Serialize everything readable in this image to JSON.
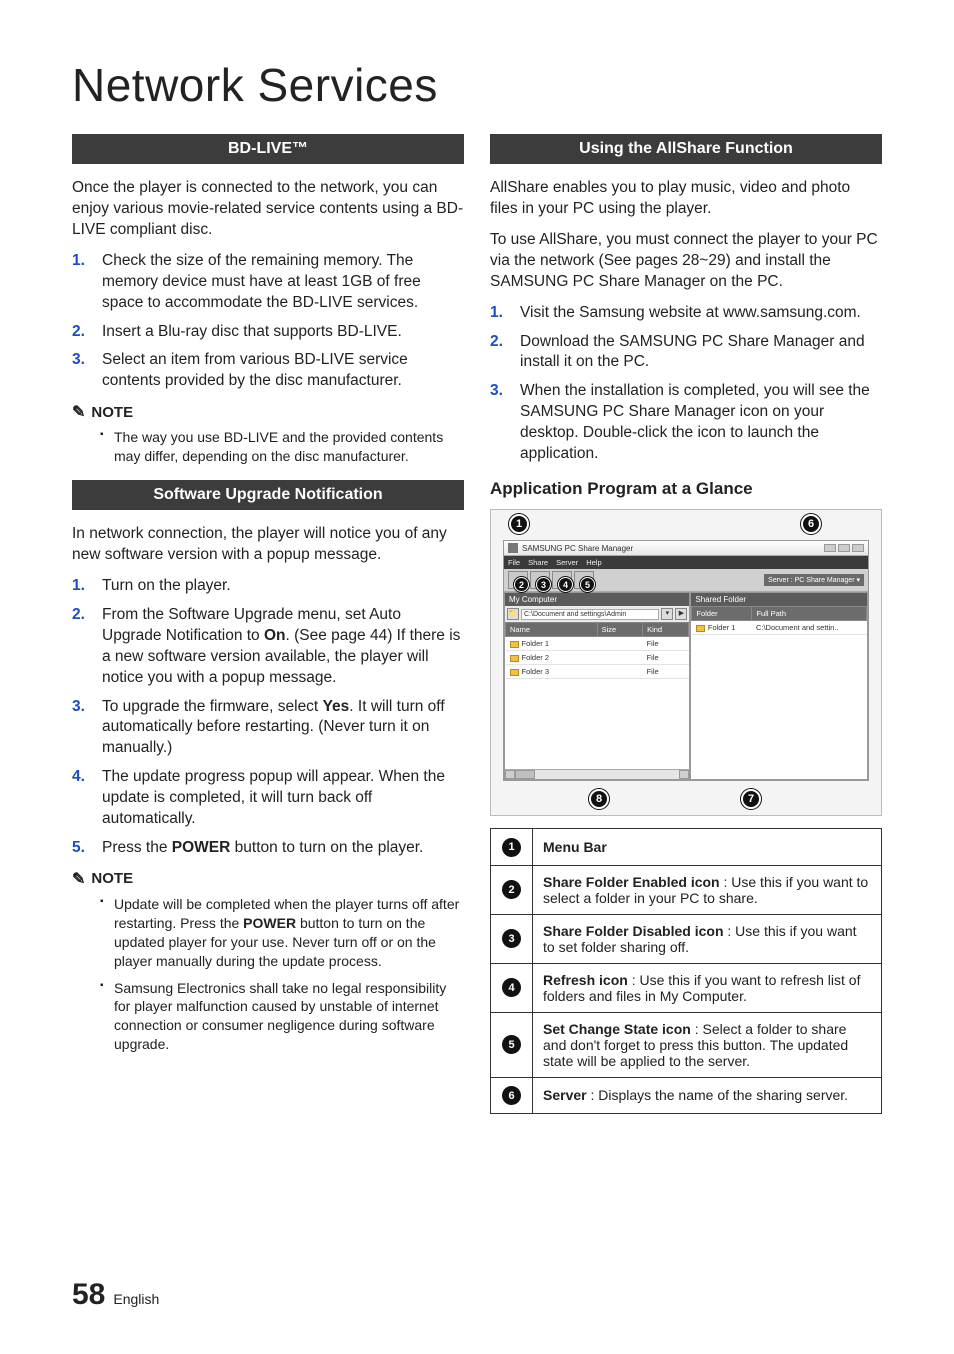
{
  "page": {
    "title": "Network Services",
    "number": "58",
    "lang": "English"
  },
  "left": {
    "section1": {
      "heading": "BD-LIVE™",
      "intro": "Once the player is connected to the network, you can enjoy various movie-related service contents using a BD-LIVE compliant disc.",
      "steps": [
        "Check the size of the remaining memory. The memory device must have at least 1GB of free space to accommodate the BD-LIVE services.",
        "Insert a Blu-ray disc that supports BD-LIVE.",
        "Select an item from various BD-LIVE service contents provided by the disc manufacturer."
      ],
      "note_label": "NOTE",
      "notes": [
        "The way you use BD-LIVE and the provided contents may differ, depending on the disc manufacturer."
      ]
    },
    "section2": {
      "heading": "Software Upgrade Notification",
      "intro": "In network connection, the player will notice you of any new software version with a popup message.",
      "steps": [
        {
          "pre": "Turn on the player."
        },
        {
          "pre": "From the Software Upgrade menu, set Auto Upgrade Notification to ",
          "bold": "On",
          "post": ". (See page 44) If there is a new software version available, the player will notice you with a popup message."
        },
        {
          "pre": "To upgrade the firmware, select ",
          "bold": "Yes",
          "post": ". It will turn off automatically before restarting. (Never turn it on manually.)"
        },
        {
          "pre": "The update progress popup will appear. When the update is completed, it will turn back off automatically."
        },
        {
          "pre": "Press the ",
          "bold": "POWER",
          "post": " button to turn on the player."
        }
      ],
      "note_label": "NOTE",
      "notes": [
        {
          "pre": "Update will be completed when the player turns off after restarting. Press the ",
          "bold": "POWER",
          "post": " button to turn on the updated player for your use. Never turn off or on the player manually during the update process."
        },
        {
          "pre": "Samsung Electronics shall take no legal responsibility for player malfunction caused by unstable of internet connection or consumer negligence during software upgrade."
        }
      ]
    }
  },
  "right": {
    "section1": {
      "heading": "Using the AllShare Function",
      "para1": "AllShare enables you to play music, video and photo files in your PC using the player.",
      "para2": "To use AllShare, you must connect the player to your PC via the network (See pages 28~29) and install the SAMSUNG PC Share Manager on the PC.",
      "steps": [
        "Visit the Samsung website at www.samsung.com.",
        "Download the SAMSUNG PC Share Manager and install it on the PC.",
        "When the installation is completed, you will see the SAMSUNG PC Share Manager icon on your desktop. Double-click the icon to launch the application."
      ]
    },
    "subhead": "Application Program at a Glance",
    "app": {
      "title": "SAMSUNG PC Share Manager",
      "menus": [
        "File",
        "Share",
        "Server",
        "Help"
      ],
      "server_label": "Server : PC Share Manager ▾",
      "left_pane": {
        "title": "My Computer",
        "path": "C:\\Document and settings\\Admin",
        "cols": [
          "Name",
          "Size",
          "Kind"
        ],
        "rows": [
          {
            "name": "Folder 1",
            "size": "",
            "kind": "File"
          },
          {
            "name": "Folder 2",
            "size": "",
            "kind": "File"
          },
          {
            "name": "Folder 3",
            "size": "",
            "kind": "File"
          }
        ]
      },
      "right_pane": {
        "title": "Shared Folder",
        "cols": [
          "Folder",
          "Full Path"
        ],
        "rows": [
          {
            "folder": "Folder 1",
            "path": "C:\\Document and settin.."
          }
        ]
      }
    },
    "legend": [
      {
        "n": "1",
        "bold": "Menu Bar",
        "rest": ""
      },
      {
        "n": "2",
        "bold": "Share Folder Enabled icon",
        "rest": " : Use this if you want to select a folder in your PC to share."
      },
      {
        "n": "3",
        "bold": "Share Folder Disabled icon",
        "rest": " : Use this if you want to set folder sharing off."
      },
      {
        "n": "4",
        "bold": "Refresh icon",
        "rest": " : Use this if you want to refresh list of folders and files in My Computer."
      },
      {
        "n": "5",
        "bold": "Set Change State icon",
        "rest": " : Select a folder to share and don't forget to press this button. The updated state will be applied to the server."
      },
      {
        "n": "6",
        "bold": "Server",
        "rest": " : Displays the name of the sharing server."
      }
    ]
  }
}
